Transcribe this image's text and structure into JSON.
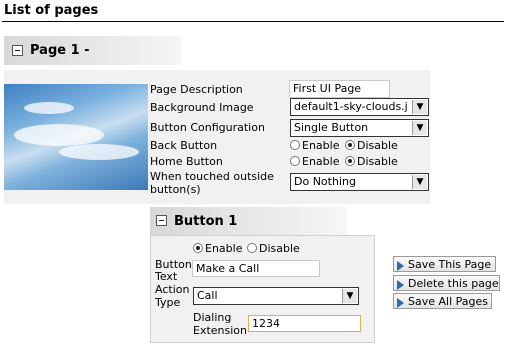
{
  "title": "List of pages",
  "page": {
    "header": "Page 1 -",
    "labels": {
      "description": "Page Description",
      "background": "Background Image",
      "button_config": "Button Configuration",
      "back": "Back Button",
      "home": "Home Button",
      "touched1": "When touched outside",
      "touched2": "button(s)"
    },
    "description_value": "First UI Page",
    "background_value": "default1-sky-clouds.j",
    "button_config_value": "Single Button",
    "back_options": {
      "enable": "Enable",
      "disable": "Disable",
      "selected": "Disable"
    },
    "home_options": {
      "enable": "Enable",
      "disable": "Disable",
      "selected": "Disable"
    },
    "touched_value": "Do Nothing"
  },
  "button": {
    "header": "Button 1",
    "state": {
      "enable": "Enable",
      "disable": "Disable",
      "selected": "Enable"
    },
    "labels": {
      "text1": "Button",
      "text2": "Text",
      "action1": "Action",
      "action2": "Type",
      "dial1": "Dialing",
      "dial2": "Extension"
    },
    "text_value": "Make a Call",
    "action_value": "Call",
    "dial_value": "1234"
  },
  "actions": {
    "save_page": "Save This Page",
    "delete_page": "Delete this page",
    "save_all": "Save All Pages"
  },
  "icons": [
    "collapse-icon",
    "dropdown-arrow-icon",
    "play-triangle-icon"
  ]
}
